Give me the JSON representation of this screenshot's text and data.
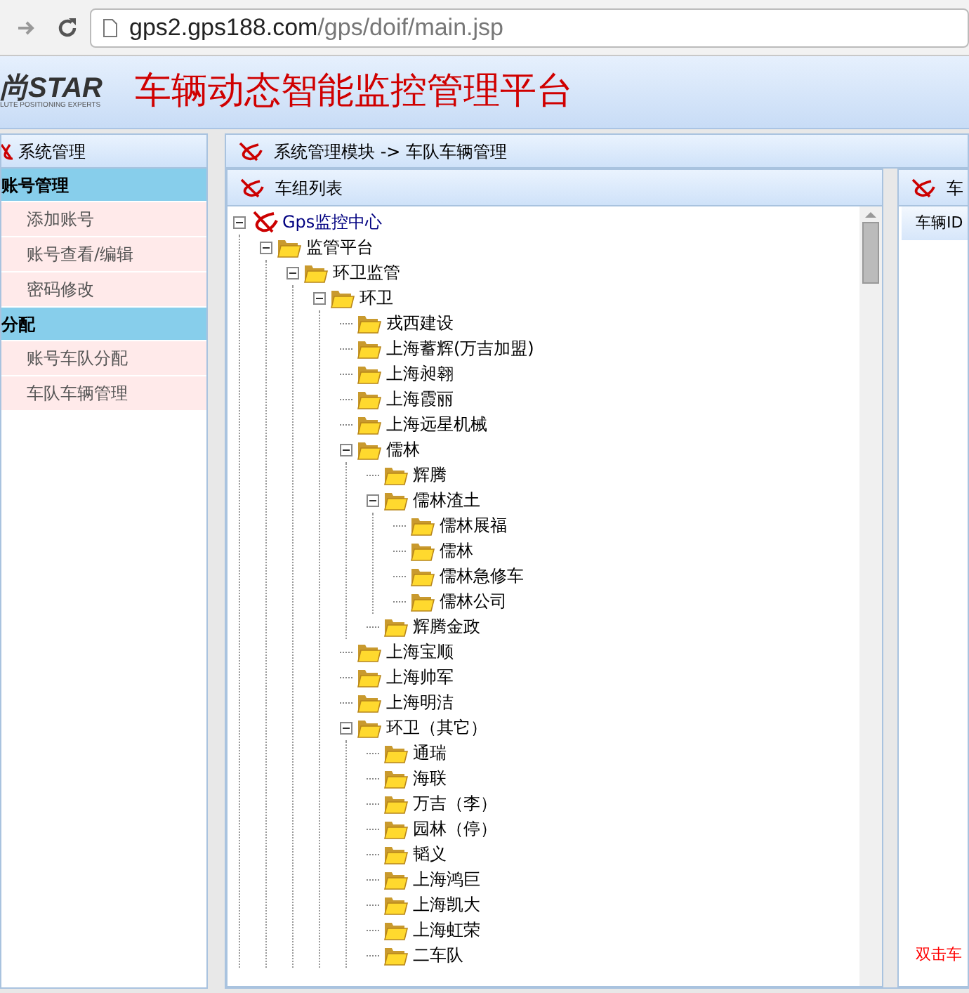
{
  "browser": {
    "url_host": "gps2.gps188.com",
    "url_path": "/gps/doif/main.jsp"
  },
  "header": {
    "logo": "尚STAR",
    "logo_tagline": "LUTE POSITIONING EXPERTS",
    "title": "车辆动态智能监控管理平台"
  },
  "sidebar": {
    "title": "系统管理",
    "groups": [
      {
        "label": "账号管理",
        "items": [
          {
            "label": "添加账号"
          },
          {
            "label": "账号查看/编辑"
          },
          {
            "label": "密码修改"
          }
        ]
      },
      {
        "label": "分配",
        "items": [
          {
            "label": "账号车队分配"
          },
          {
            "label": "车队车辆管理"
          }
        ]
      }
    ]
  },
  "breadcrumb": "系统管理模块 -> 车队车辆管理",
  "tree_panel": {
    "title": "车组列表",
    "tree": [
      {
        "label": "Gps监控中心",
        "kind": "root",
        "expanded": true,
        "children": [
          {
            "label": "监管平台",
            "kind": "folder",
            "expanded": true,
            "children": [
              {
                "label": "环卫监管",
                "kind": "folder",
                "expanded": true,
                "children": [
                  {
                    "label": "环卫",
                    "kind": "folder",
                    "expanded": true,
                    "children": [
                      {
                        "label": "戎西建设",
                        "kind": "folder"
                      },
                      {
                        "label": "上海蓄辉(万吉加盟)",
                        "kind": "folder"
                      },
                      {
                        "label": "上海昶翱",
                        "kind": "folder"
                      },
                      {
                        "label": "上海霞丽",
                        "kind": "folder"
                      },
                      {
                        "label": "上海远星机械",
                        "kind": "folder"
                      },
                      {
                        "label": "儒林",
                        "kind": "folder",
                        "expanded": true,
                        "children": [
                          {
                            "label": "辉腾",
                            "kind": "folder"
                          },
                          {
                            "label": "儒林渣土",
                            "kind": "folder",
                            "expanded": true,
                            "children": [
                              {
                                "label": "儒林展福",
                                "kind": "folder"
                              },
                              {
                                "label": "儒林",
                                "kind": "folder"
                              },
                              {
                                "label": "儒林急修车",
                                "kind": "folder"
                              },
                              {
                                "label": "儒林公司",
                                "kind": "folder"
                              }
                            ]
                          },
                          {
                            "label": "辉腾金政",
                            "kind": "folder"
                          }
                        ]
                      },
                      {
                        "label": "上海宝顺",
                        "kind": "folder"
                      },
                      {
                        "label": "上海帅军",
                        "kind": "folder"
                      },
                      {
                        "label": "上海明洁",
                        "kind": "folder"
                      },
                      {
                        "label": "环卫（其它）",
                        "kind": "folder",
                        "expanded": true,
                        "children": [
                          {
                            "label": "通瑞",
                            "kind": "folder"
                          },
                          {
                            "label": "海联",
                            "kind": "folder"
                          },
                          {
                            "label": "万吉（李）",
                            "kind": "folder"
                          },
                          {
                            "label": "园林（停）",
                            "kind": "folder"
                          },
                          {
                            "label": "韬义",
                            "kind": "folder"
                          },
                          {
                            "label": "上海鸿巨",
                            "kind": "folder"
                          },
                          {
                            "label": "上海凯大",
                            "kind": "folder"
                          },
                          {
                            "label": "上海虹荣",
                            "kind": "folder"
                          },
                          {
                            "label": "二车队",
                            "kind": "folder"
                          }
                        ]
                      }
                    ]
                  }
                ]
              }
            ]
          }
        ]
      }
    ]
  },
  "vehicle_panel": {
    "title": "车",
    "column_1": "车辆ID",
    "hint": "双击车"
  }
}
